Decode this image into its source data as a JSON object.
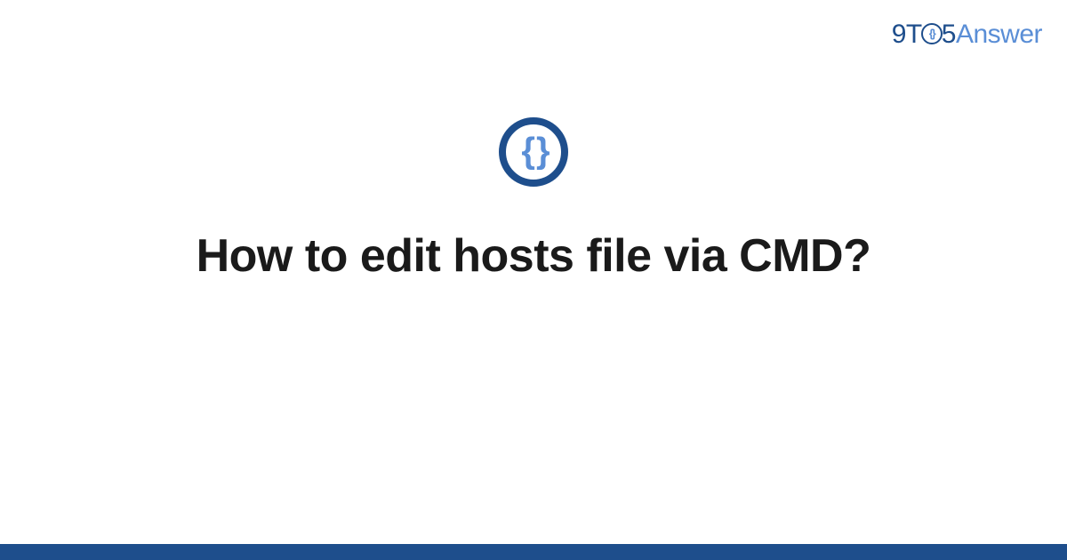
{
  "brand": {
    "prefix": "9T",
    "middle_glyph": "{}",
    "digit": "5",
    "suffix": "Answer"
  },
  "icon": {
    "glyph": "{ }"
  },
  "title": "How to edit hosts file via CMD?",
  "colors": {
    "primary": "#1e4e8c",
    "accent": "#5a8ed6"
  }
}
